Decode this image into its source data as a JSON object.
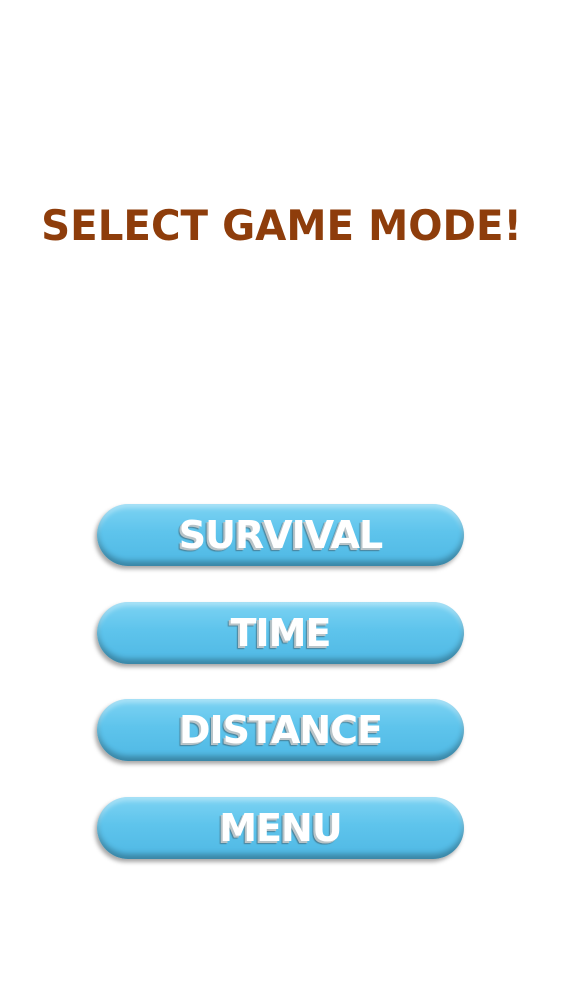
{
  "title": "SELECT GAME MODE!",
  "buttons": {
    "survival": "SURVIVAL",
    "time": "TIME",
    "distance": "DISTANCE",
    "menu": "MENU"
  },
  "colors": {
    "title": "#8e3d0b",
    "button": "#5ec4ec",
    "button_text": "#ffffff",
    "background": "#ffffff"
  }
}
